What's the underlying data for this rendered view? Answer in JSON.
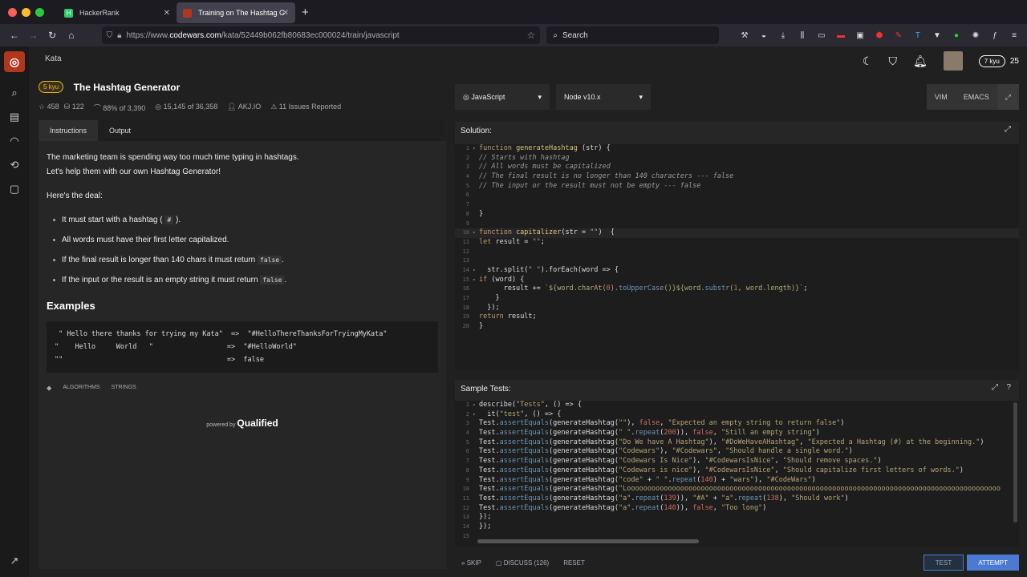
{
  "browser": {
    "tabs": [
      {
        "label": "HackerRank"
      },
      {
        "label": "Training on The Hashtag Genera"
      }
    ],
    "url_prefix": "https://www.",
    "url_domain": "codewars.com",
    "url_path": "/kata/52449b062fb80683ec000024/train/javascript",
    "search_placeholder": "Search"
  },
  "header": {
    "breadcrumb": "Kata",
    "rank_badge": "7 kyu",
    "honor": "25"
  },
  "kata": {
    "kyu": "5 kyu",
    "title": "The Hashtag Generator",
    "stats": {
      "stars": "458",
      "collections": "122",
      "satisfaction": "88% of 3,390",
      "completed": "15,145 of 36,358",
      "author": "AKJ.IO",
      "issues": "11 Issues Reported"
    }
  },
  "instructions": {
    "tabs": [
      "Instructions",
      "Output"
    ],
    "intro1": "The marketing team is spending way too much time typing in hashtags.",
    "intro2": "Let's help them with our own Hashtag Generator!",
    "deal": "Here's the deal:",
    "rules": [
      {
        "text": "It must start with a hashtag (",
        "code": "#",
        "tail": ")."
      },
      {
        "text": "All words must have their first letter capitalized.",
        "code": "",
        "tail": ""
      },
      {
        "text": "If the final result is longer than 140 chars it must return",
        "code": "false",
        "tail": "."
      },
      {
        "text": "If the input or the result is an empty string it must return",
        "code": "false",
        "tail": "."
      }
    ],
    "examples_heading": "Examples",
    "examples": " \" Hello there thanks for trying my Kata\"  =>  \"#HelloThereThanksForTryingMyKata\"\n\"    Hello     World   \"                  =>  \"#HelloWorld\"\n\"\"                                        =>  false",
    "tags": [
      "ALGORITHMS",
      "STRINGS"
    ],
    "powered_by": "powered by",
    "brand": "Qualified"
  },
  "editor": {
    "language": "JavaScript",
    "runtime": "Node v10.x",
    "modes": [
      "VIM",
      "EMACS"
    ],
    "solution_label": "Solution:",
    "tests_label": "Sample Tests:"
  },
  "actions": {
    "skip": "SKIP",
    "discuss": "DISCUSS (126)",
    "reset": "RESET",
    "test": "TEST",
    "attempt": "ATTEMPT"
  },
  "colors": {
    "accent": "#b1361e",
    "kyu": "#ecb613",
    "attempt": "#4a7bd0"
  }
}
